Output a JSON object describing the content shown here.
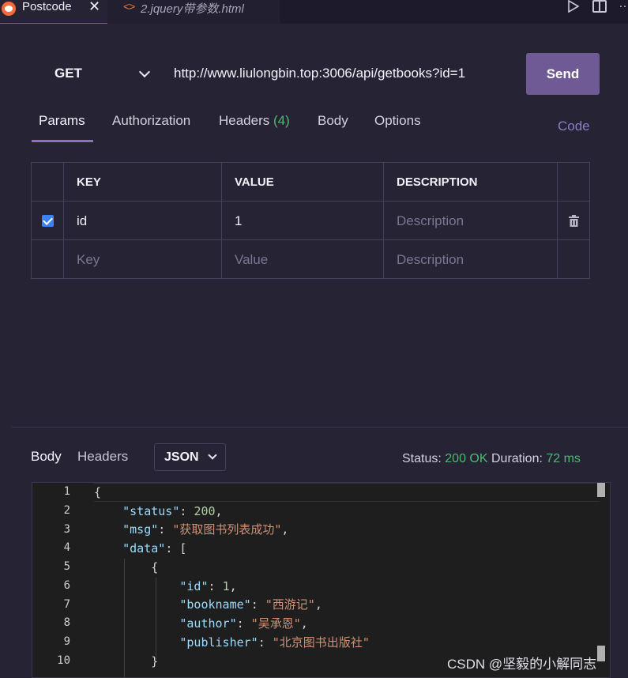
{
  "tabs": {
    "active_title": "Postcode",
    "close_glyph": "✕",
    "second_title": "2.jquery带参数.html",
    "second_icon": "<>"
  },
  "request": {
    "method": "GET",
    "url": "http://www.liulongbin.top:3006/api/getbooks?id=1",
    "send_label": "Send"
  },
  "request_tabs": {
    "params": "Params",
    "authorization": "Authorization",
    "headers": "Headers",
    "headers_count": "(4)",
    "body": "Body",
    "options": "Options",
    "code": "Code"
  },
  "params_table": {
    "headers": [
      "KEY",
      "VALUE",
      "DESCRIPTION"
    ],
    "rows": [
      {
        "checked": true,
        "key": "id",
        "value": "1",
        "description_placeholder": "Description"
      }
    ],
    "empty_row": {
      "key_placeholder": "Key",
      "value_placeholder": "Value",
      "description_placeholder": "Description"
    }
  },
  "response": {
    "tab_body": "Body",
    "tab_headers": "Headers",
    "format": "JSON",
    "status_label": "Status:",
    "status_value": "200 OK",
    "duration_label": "Duration:",
    "duration_value": "72 ms"
  },
  "editor": {
    "line_numbers": [
      "1",
      "2",
      "3",
      "4",
      "5",
      "6",
      "7",
      "8",
      "9",
      "10"
    ],
    "lines": {
      "l1_open": "{",
      "status_key": "\"status\"",
      "status_val": "200",
      "msg_key": "\"msg\"",
      "msg_val": "\"获取图书列表成功\"",
      "data_key": "\"data\"",
      "data_open": "[",
      "obj_open": "{",
      "id_key": "\"id\"",
      "id_val": "1",
      "bookname_key": "\"bookname\"",
      "bookname_val": "\"西游记\"",
      "author_key": "\"author\"",
      "author_val": "\"吴承恩\"",
      "publisher_key": "\"publisher\"",
      "publisher_val": "\"北京图书出版社\"",
      "obj_close": "}"
    }
  },
  "watermark": "CSDN @坚毅的小解同志",
  "colors": {
    "background": "#262335",
    "send_button": "#6f5a96",
    "accent_green": "#4fb870",
    "code_link": "#8b7ec8",
    "postcode_icon": "#f26b3a"
  },
  "icons": {
    "postcode": "postcode-logo-icon",
    "close": "close-icon",
    "html_file": "html-file-icon",
    "run": "run-icon",
    "split": "split-editor-icon",
    "more": "more-icon",
    "method_dropdown": "chevron-down-icon",
    "checkbox": "checkbox-icon",
    "delete": "trash-icon"
  }
}
